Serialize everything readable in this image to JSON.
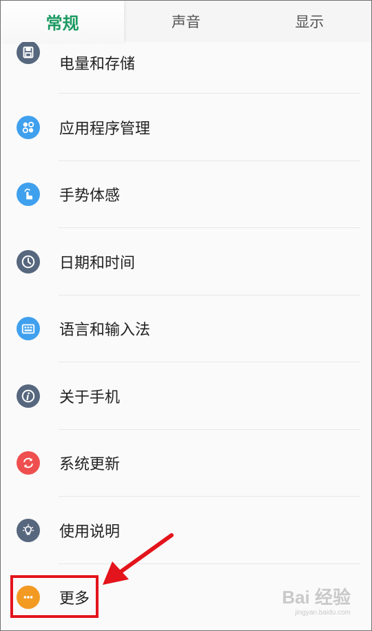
{
  "tabs": [
    {
      "label": "常规",
      "active": true
    },
    {
      "label": "声音",
      "active": false
    },
    {
      "label": "显示",
      "active": false
    }
  ],
  "items": [
    {
      "label": "电量和存储",
      "icon": "save-icon",
      "color": "#56677e"
    },
    {
      "label": "应用程序管理",
      "icon": "apps-icon",
      "color": "#3fa0ee"
    },
    {
      "label": "手势体感",
      "icon": "gesture-icon",
      "color": "#3fa0ee"
    },
    {
      "label": "日期和时间",
      "icon": "clock-icon",
      "color": "#56677e"
    },
    {
      "label": "语言和输入法",
      "icon": "keyboard-icon",
      "color": "#3fa0ee"
    },
    {
      "label": "关于手机",
      "icon": "info-icon",
      "color": "#56677e"
    },
    {
      "label": "系统更新",
      "icon": "refresh-icon",
      "color": "#ef4f4f"
    },
    {
      "label": "使用说明",
      "icon": "lightbulb-icon",
      "color": "#56677e"
    },
    {
      "label": "更多",
      "icon": "more-icon",
      "color": "#f39a23"
    }
  ],
  "annotation": {
    "highlight_color": "#e3141b"
  },
  "watermark": {
    "brand": "Bai 经验",
    "sub": "jingyan.baidu.com"
  }
}
